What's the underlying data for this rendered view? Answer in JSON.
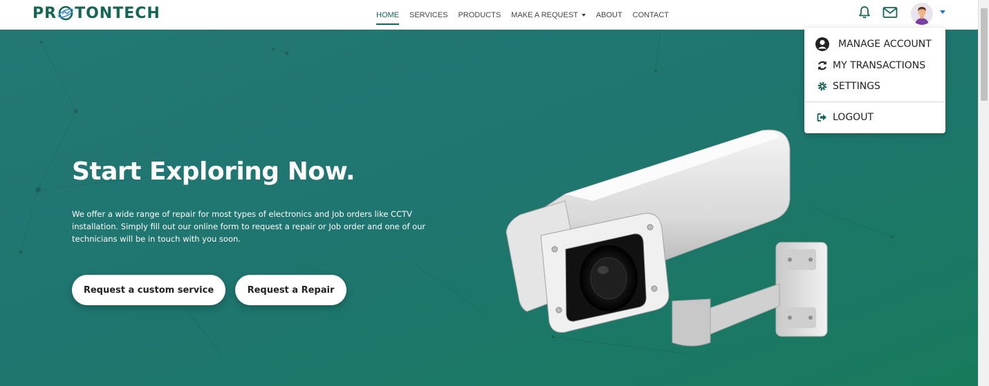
{
  "brand": {
    "logo_left": "PR",
    "logo_right": "TONTECH",
    "color": "#136554"
  },
  "nav": {
    "links": [
      {
        "label": "HOME",
        "active": true
      },
      {
        "label": "SERVICES"
      },
      {
        "label": "PRODUCTS"
      },
      {
        "label": "MAKE A REQUEST"
      },
      {
        "label": "ABOUT"
      },
      {
        "label": "CONTACT"
      }
    ],
    "icons": [
      "bell-icon",
      "mail-icon",
      "avatar",
      "chevron-down-icon"
    ]
  },
  "hero": {
    "title": "Start Exploring Now.",
    "text": "We offer a wide range of repair for most types of electronics and Job orders like CCTV installation. Simply fill out our online form to request a repair or Job order and one of our technicians will be in touch with you soon.",
    "button_custom": "Request a custom service",
    "button_repair": "Request a Repair",
    "background": "#1f7570"
  },
  "dropdown": {
    "items": [
      {
        "label": "MANAGE ACCOUNT",
        "icon": "user-circle-icon"
      },
      {
        "label": "MY TRANSACTIONS",
        "icon": "sync-icon"
      },
      {
        "label": "SETTINGS",
        "icon": "gear-icon"
      },
      {
        "label": "LOGOUT",
        "icon": "logout-icon"
      }
    ]
  }
}
